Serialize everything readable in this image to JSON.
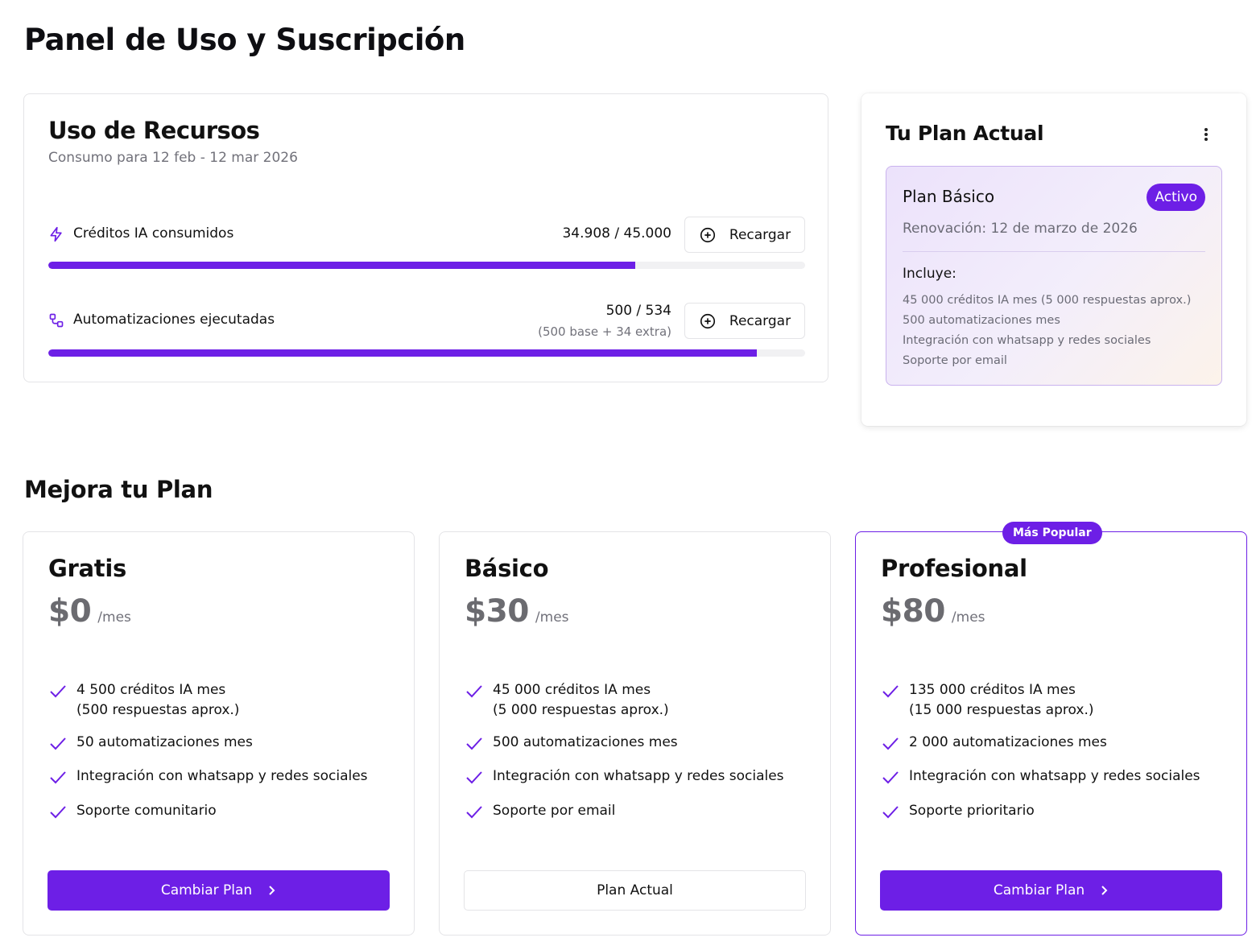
{
  "page_title": "Panel de Uso y Suscripción",
  "usage": {
    "title": "Uso de Recursos",
    "subtitle": "Consumo para 12 feb - 12 mar 2026",
    "resources": [
      {
        "icon": "lightning-icon",
        "label": "Créditos IA consumidos",
        "value": "34.908 / 45.000",
        "extra": "",
        "button_label": "Recargar",
        "progress_percent": 77.6
      },
      {
        "icon": "workflow-icon",
        "label": "Automatizaciones ejecutadas",
        "value": "500 / 534",
        "extra": "(500 base + 34 extra)",
        "button_label": "Recargar",
        "progress_percent": 93.6
      }
    ]
  },
  "current_plan": {
    "title": "Tu Plan Actual",
    "plan_name": "Plan Básico",
    "status_badge": "Activo",
    "renewal": "Renovación: 12 de marzo de 2026",
    "includes_label": "Incluye:",
    "includes": [
      "45 000 créditos IA mes (5 000 respuestas aprox.)",
      "500 automatizaciones mes",
      "Integración con whatsapp y redes sociales",
      "Soporte por email"
    ]
  },
  "upgrade": {
    "title": "Mejora tu Plan",
    "popular_badge": "Más Popular",
    "tiers": [
      {
        "name": "Gratis",
        "price": "$0",
        "period": "/mes",
        "features": [
          "4 500 créditos IA mes\n(500 respuestas aprox.)",
          "50 automatizaciones mes",
          "Integración con whatsapp y redes sociales",
          "Soporte comunitario"
        ],
        "button_label": "Cambiar Plan"
      },
      {
        "name": "Básico",
        "price": "$30",
        "period": "/mes",
        "features": [
          "45 000 créditos IA mes\n(5 000 respuestas aprox.)",
          "500 automatizaciones mes",
          "Integración con whatsapp y redes sociales",
          "Soporte por email"
        ],
        "button_label": "Plan Actual"
      },
      {
        "name": "Profesional",
        "price": "$80",
        "period": "/mes",
        "features": [
          "135 000 créditos IA mes\n(15 000 respuestas aprox.)",
          "2 000 automatizaciones mes",
          "Integración con whatsapp y redes sociales",
          "Soporte prioritario"
        ],
        "button_label": "Cambiar Plan"
      }
    ]
  },
  "colors": {
    "accent": "#6d1fe6",
    "muted_text": "#71717a",
    "border": "#e4e4e7"
  }
}
